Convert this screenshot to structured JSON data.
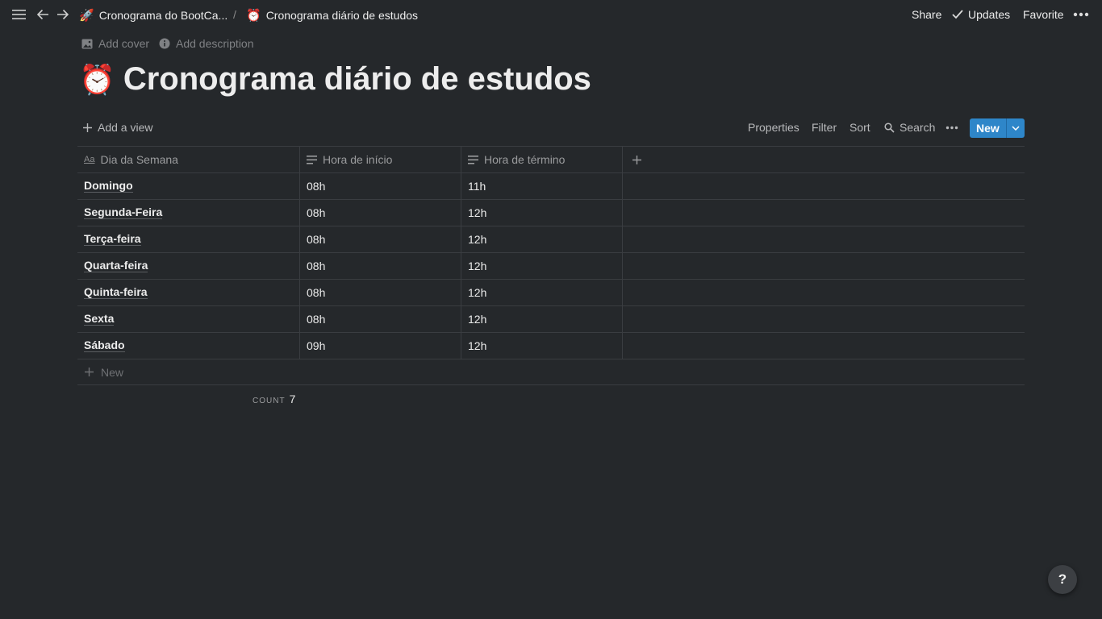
{
  "topbar": {
    "breadcrumbs": [
      {
        "emoji": "🚀",
        "label": "Cronograma do BootCa..."
      },
      {
        "emoji": "⏰",
        "label": "Cronograma diário de estudos"
      }
    ],
    "separator": "/",
    "share": "Share",
    "updates": "Updates",
    "favorite": "Favorite"
  },
  "page": {
    "add_cover": "Add cover",
    "add_description": "Add description",
    "title_emoji": "⏰",
    "title": "Cronograma diário de estudos"
  },
  "toolbar": {
    "add_view": "Add a view",
    "properties": "Properties",
    "filter": "Filter",
    "sort": "Sort",
    "search": "Search",
    "new": "New"
  },
  "table": {
    "columns": [
      {
        "icon": "Aa",
        "label": "Dia da Semana"
      },
      {
        "label": "Hora de início"
      },
      {
        "label": "Hora de término"
      }
    ],
    "rows": [
      {
        "day": "Domingo",
        "start": "08h",
        "end": "11h"
      },
      {
        "day": "Segunda-Feira",
        "start": "08h",
        "end": "12h"
      },
      {
        "day": "Terça-feira",
        "start": "08h",
        "end": "12h"
      },
      {
        "day": "Quarta-feira",
        "start": "08h",
        "end": "12h"
      },
      {
        "day": "Quinta-feira",
        "start": "08h",
        "end": "12h"
      },
      {
        "day": "Sexta",
        "start": "08h",
        "end": "12h"
      },
      {
        "day": "Sábado",
        "start": "09h",
        "end": "12h"
      }
    ],
    "new_row": "New",
    "count_label": "COUNT",
    "count_value": "7"
  },
  "help": "?",
  "colors": {
    "background": "#25282b",
    "accent": "#2e86c9"
  }
}
